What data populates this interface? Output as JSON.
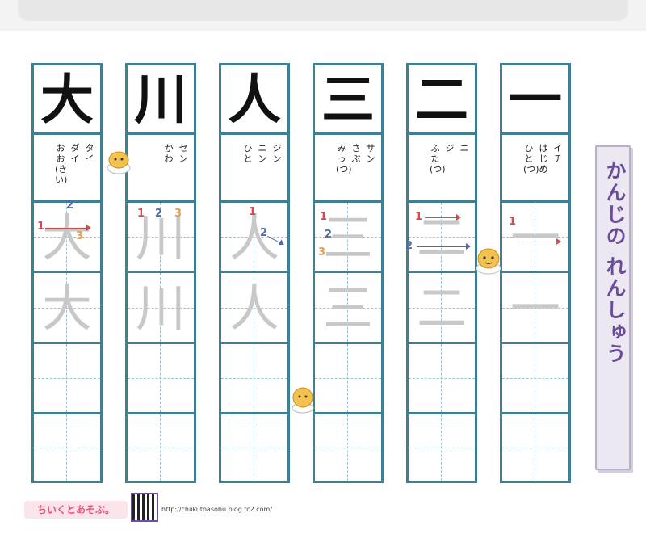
{
  "columns": [
    {
      "kanji": "大",
      "readings": {
        "on": "タイ",
        "kun": "ダイ",
        "kun2": "おお(きい)"
      }
    },
    {
      "kanji": "川",
      "readings": {
        "on": "セン",
        "kun": "かわ",
        "kun2": ""
      }
    },
    {
      "kanji": "人",
      "readings": {
        "on": "ジン",
        "kun": "ニン",
        "kun2": "ひと"
      }
    },
    {
      "kanji": "三",
      "readings": {
        "on": "サン",
        "kun": "さぶ",
        "kun2": "みっ(つ)"
      }
    },
    {
      "kanji": "二",
      "readings": {
        "on": "ニ",
        "kun": "ジ",
        "kun2": "ふた(つ)"
      }
    },
    {
      "kanji": "一",
      "readings": {
        "on": "イチ",
        "kun": "はじめ",
        "kun2": "ひと(つ)"
      }
    }
  ],
  "stroke_labels": [
    "1",
    "2",
    "3"
  ],
  "title": "かんじの れんしゅう",
  "footer": {
    "logo_text": "ちいくとあそぶ。",
    "url": "http://chiikutoasobu.blog.fc2.com/"
  },
  "colors": {
    "grid": "#3f7f93",
    "title": "#6a4c9a",
    "stroke1": "#d64a4a",
    "stroke2": "#4d6ab0",
    "stroke3": "#e6a04a"
  }
}
